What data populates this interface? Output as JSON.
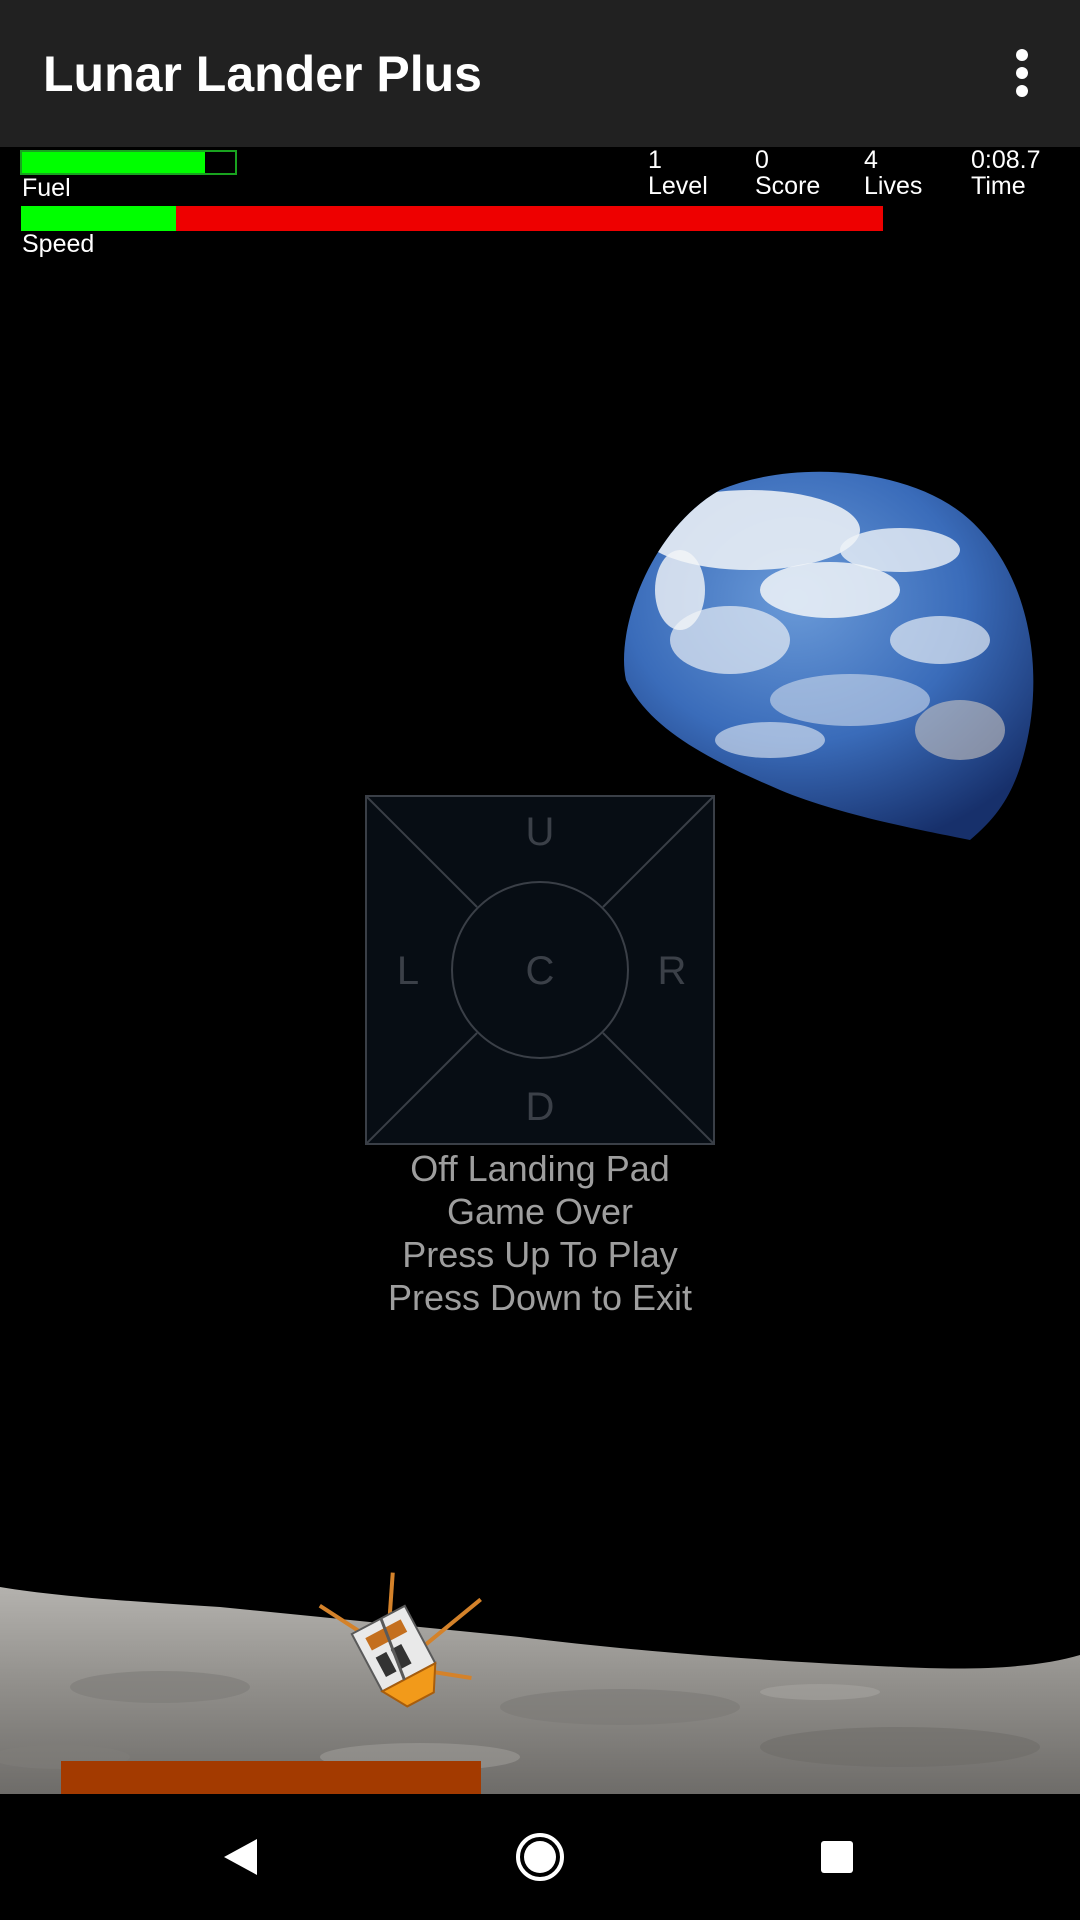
{
  "app_bar": {
    "title": "Lunar Lander Plus",
    "overflow_icon": "more-vert-icon"
  },
  "hud": {
    "fuel": {
      "label": "Fuel",
      "level": 0.86
    },
    "speed": {
      "label": "Speed",
      "level": 0.18
    },
    "stats": [
      {
        "key": "level",
        "value": "1",
        "label": "Level"
      },
      {
        "key": "score",
        "value": "0",
        "label": "Score"
      },
      {
        "key": "lives",
        "value": "4",
        "label": "Lives"
      },
      {
        "key": "time",
        "value": "0:08.7",
        "label": "Time"
      }
    ]
  },
  "dpad": {
    "up": "U",
    "down": "D",
    "left": "L",
    "right": "R",
    "center": "C"
  },
  "messages": [
    "Off Landing Pad",
    "Game Over",
    "Press Up To Play",
    "Press Down to Exit"
  ],
  "nav_bar": {
    "back_icon": "back-triangle-icon",
    "home_icon": "home-circle-icon",
    "recents_icon": "recents-square-icon"
  },
  "colors": {
    "app_bar_bg": "#212121",
    "fuel_fill": "#00ff00",
    "speed_good": "#00ff00",
    "speed_bad": "#ee0000",
    "landing_pad": "#a33a00",
    "message_text": "#9e9e9e"
  }
}
